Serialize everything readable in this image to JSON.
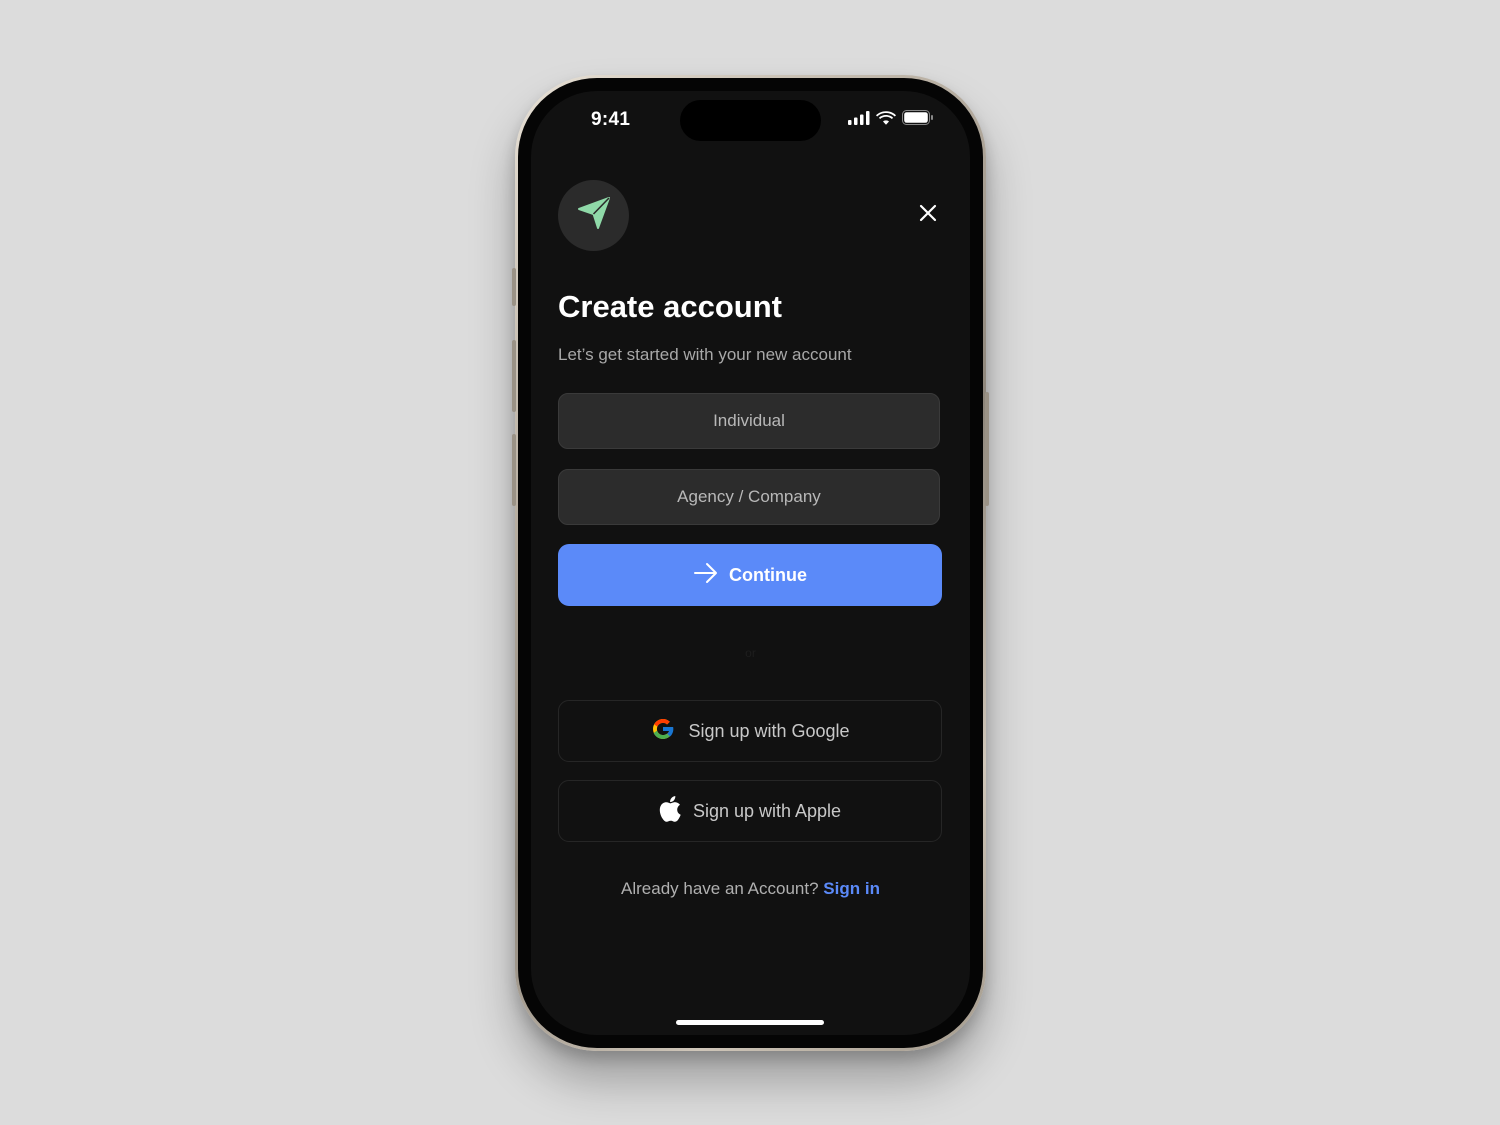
{
  "status_bar": {
    "time": "9:41",
    "icons": [
      "cellular-signal-icon",
      "wifi-icon",
      "battery-icon"
    ]
  },
  "header": {
    "logo_icon": "paper-plane-icon",
    "logo_color": "#8fd9a8",
    "close_icon": "close-icon"
  },
  "main": {
    "title": "Create account",
    "subtitle": "Let’s get started with your new account",
    "options": [
      {
        "label": "Individual"
      },
      {
        "label": "Agency / Company"
      }
    ],
    "continue_label": "Continue",
    "continue_icon": "arrow-right-icon",
    "divider_text": "or",
    "social": [
      {
        "label": "Sign up with Google",
        "icon": "google-icon"
      },
      {
        "label": "Sign up with Apple",
        "icon": "apple-icon"
      }
    ],
    "signin_prompt": "Already have an Account?",
    "signin_link": "Sign in"
  },
  "colors": {
    "accent": "#5b8af9",
    "background": "#111111",
    "surface": "#2c2c2c"
  }
}
